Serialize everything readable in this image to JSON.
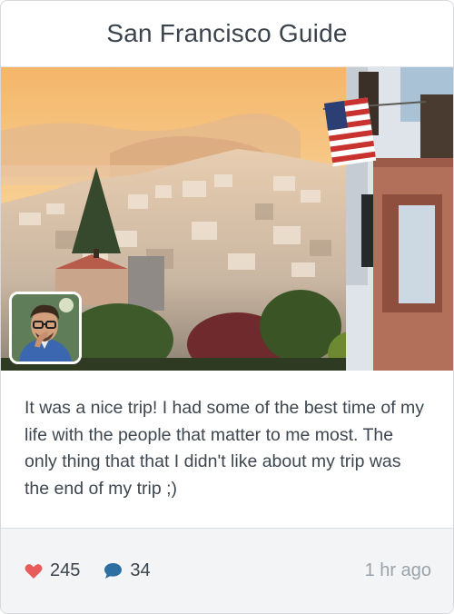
{
  "card": {
    "title": "San Francisco Guide",
    "caption": "It was a nice trip! I had some of the best time of my life with the people that matter to me most. The only thing that that I didn't like about my trip was the end of my trip ;)",
    "likes": "245",
    "comments": "34",
    "timestamp": "1 hr ago"
  },
  "colors": {
    "heart": "#e85b5b",
    "comment": "#2d6ea3",
    "timestamp": "#9aa3ab",
    "title": "#3b444d"
  },
  "icons": {
    "like": "heart-icon",
    "comment": "speech-bubble-icon"
  }
}
